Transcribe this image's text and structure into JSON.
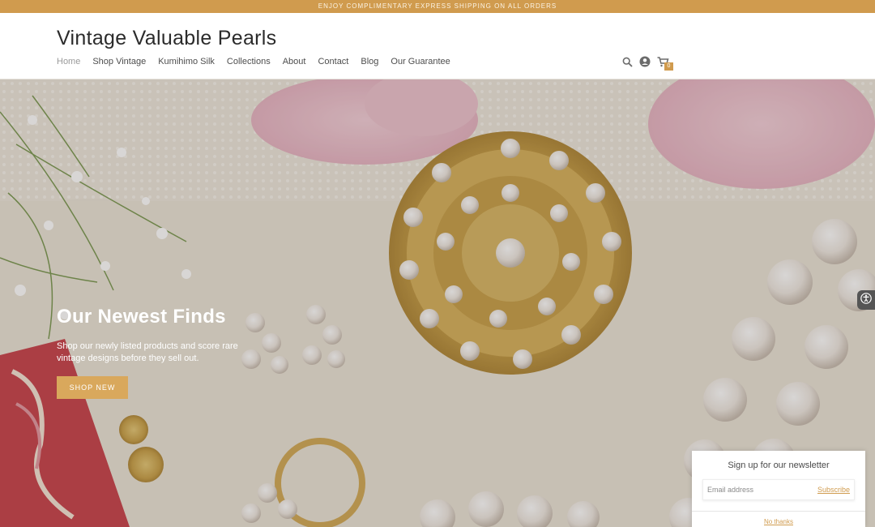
{
  "announcement": {
    "text": "ENJOY COMPLIMENTARY EXPRESS SHIPPING ON ALL ORDERS"
  },
  "header": {
    "logo": "Vintage Valuable Pearls",
    "nav": [
      "Home",
      "Shop Vintage",
      "Kumihimo Silk",
      "Collections",
      "About",
      "Contact",
      "Blog",
      "Our Guarantee"
    ],
    "active_nav": "Home",
    "icons": [
      "search-icon",
      "account-icon",
      "cart-icon"
    ],
    "cart_count": "0"
  },
  "hero": {
    "title": "Our Newest Finds",
    "subtitle": "Shop our newly listed products and score rare vintage designs before they sell out.",
    "button": "SHOP NEW"
  },
  "newsletter": {
    "title": "Sign up for our newsletter",
    "placeholder": "Email address",
    "subscribe": "Subscribe",
    "no_thanks": "No thanks"
  },
  "colors": {
    "accent": "#d09b4e",
    "button": "#d9a85c",
    "text_dark": "#2b2b2b"
  }
}
